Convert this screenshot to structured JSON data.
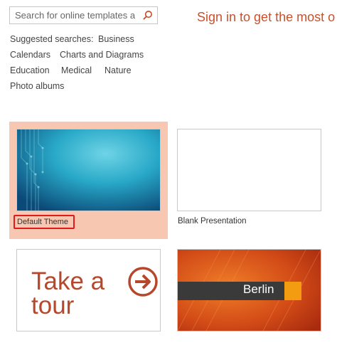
{
  "search": {
    "placeholder": "Search for online templates a",
    "icon": "search-icon"
  },
  "signin": {
    "label": "Sign in to get the most o"
  },
  "suggested": {
    "heading": "Suggested searches:",
    "items": [
      "Business",
      "Calendars",
      "Charts and Diagrams",
      "Education",
      "Medical",
      "Nature",
      "Photo albums"
    ]
  },
  "templates": [
    {
      "label": "Default Theme",
      "selected": true
    },
    {
      "label": "Blank Presentation",
      "selected": false
    },
    {
      "label": "Take a tour",
      "lines": [
        "Take a",
        "tour"
      ],
      "icon": "arrow-circle-icon"
    },
    {
      "label": "Berlin"
    }
  ],
  "colors": {
    "accent": "#c7512c",
    "selected_bg": "#f8c7b1",
    "highlight_border": "#e21a1a"
  }
}
